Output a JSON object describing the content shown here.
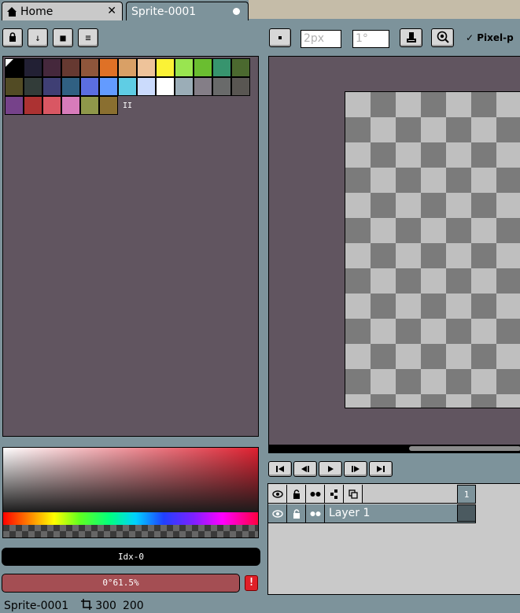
{
  "tabs": {
    "home": {
      "label": "Home",
      "close": "✕"
    },
    "sprite": {
      "label": "Sprite-0001"
    }
  },
  "palette_toolbar": {
    "lock": "🔒",
    "down": "↓",
    "square": "■",
    "menu": "≡"
  },
  "palette": {
    "colors": [
      "#000000",
      "#222034",
      "#45283c",
      "#663931",
      "#8f563b",
      "#df7126",
      "#d9a066",
      "#eec39a",
      "#fbf236",
      "#99e550",
      "#6abe30",
      "#37946e",
      "#4b692f",
      "#524b24",
      "#323c39",
      "#3f3f74",
      "#306082",
      "#5b6ee1",
      "#639bff",
      "#5fcde4",
      "#cbdbfc",
      "#ffffff",
      "#9badb7",
      "#847e87",
      "#696a6a",
      "#595652",
      "#76428a",
      "#ac3232",
      "#d95763",
      "#d77bba",
      "#8f974a",
      "#8a6f30"
    ],
    "marker": "II"
  },
  "brush": {
    "size": "2px",
    "angle": "1°",
    "pixel_perfect": "Pixel-p"
  },
  "color_panel": {
    "index_label": "Idx-0",
    "color_label": "0°61.5%",
    "warning": "!"
  },
  "timeline": {
    "controls": [
      "first-frame",
      "prev-frame",
      "play",
      "next-frame",
      "last-frame"
    ],
    "frame_number": "1",
    "layer_name": "Layer 1"
  },
  "status": {
    "sprite_name": "Sprite-0001",
    "width": "300",
    "height": "200"
  },
  "colors": {
    "panel_bg": "#615560",
    "ui_bg": "#7d939b",
    "active_color": "#a44e53"
  }
}
